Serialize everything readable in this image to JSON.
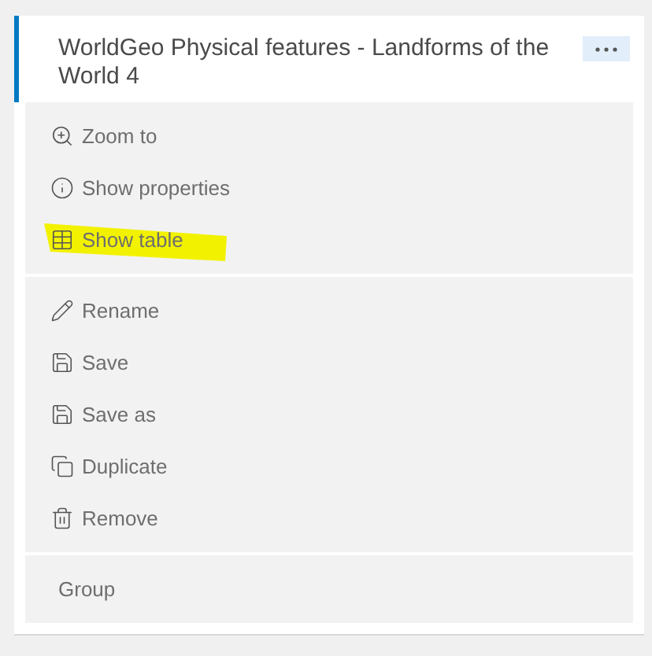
{
  "layer": {
    "title": "WorldGeo Physical features - Landforms of the World 4"
  },
  "menu_sections": [
    {
      "items": [
        {
          "kind": "zoom",
          "label": "Zoom to",
          "highlighted": false
        },
        {
          "kind": "info",
          "label": "Show properties",
          "highlighted": false
        },
        {
          "kind": "table",
          "label": "Show table",
          "highlighted": true
        }
      ]
    },
    {
      "items": [
        {
          "kind": "rename",
          "label": "Rename",
          "highlighted": false
        },
        {
          "kind": "save",
          "label": "Save",
          "highlighted": false
        },
        {
          "kind": "save",
          "label": "Save as",
          "highlighted": false
        },
        {
          "kind": "duplicate",
          "label": "Duplicate",
          "highlighted": false
        },
        {
          "kind": "remove",
          "label": "Remove",
          "highlighted": false
        }
      ]
    },
    {
      "items": [
        {
          "kind": "plain",
          "label": "Group",
          "highlighted": false
        }
      ]
    }
  ]
}
